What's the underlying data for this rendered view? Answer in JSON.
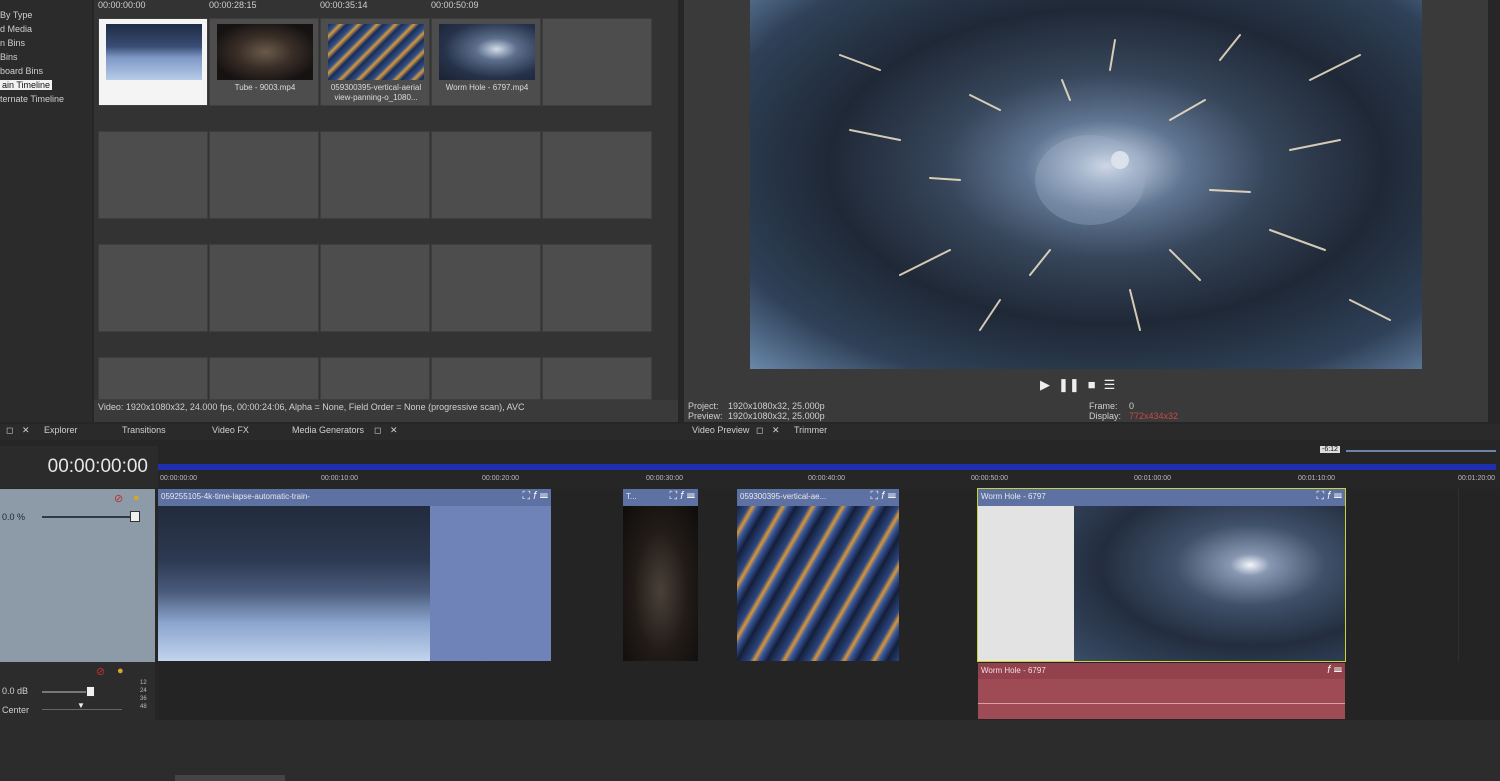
{
  "bins_tree": {
    "items": [
      {
        "label": "By Type",
        "selected": false
      },
      {
        "label": "d Media",
        "selected": false
      },
      {
        "label": "n Bins",
        "selected": false
      },
      {
        "label": "Bins",
        "selected": false
      },
      {
        "label": "board Bins",
        "selected": false
      },
      {
        "label": "ain Timeline",
        "selected": true
      },
      {
        "label": "ternate Timeline",
        "selected": false
      }
    ]
  },
  "media": {
    "timecodes": [
      "00:00:00:00",
      "00:00:28:15",
      "00:00:35:14",
      "00:00:50:09"
    ],
    "items": [
      {
        "caption": "",
        "selected": true,
        "thumb": "city-train"
      },
      {
        "caption": "Tube - 9003.mp4",
        "selected": false,
        "thumb": "tube"
      },
      {
        "caption": "059300395-vertical-aerial view-panning-o_1080...",
        "selected": false,
        "thumb": "highway"
      },
      {
        "caption": "Worm Hole - 6797.mp4",
        "selected": false,
        "thumb": "wormhole"
      }
    ],
    "info": "Video: 1920x1080x32, 24.000 fps, 00:00:24:06, Alpha = None, Field Order = None (progressive scan), AVC"
  },
  "preview": {
    "project_label": "Project:",
    "project_value": "1920x1080x32, 25.000p",
    "preview_label": "Preview:",
    "preview_value": "1920x1080x32, 25.000p",
    "frame_label": "Frame:",
    "frame_value": "0",
    "display_label": "Display:",
    "display_value": "772x434x32",
    "display_color": "#c44b4b",
    "transport": [
      "play-icon",
      "pause-icon",
      "stop-icon",
      "menu-icon"
    ]
  },
  "tabs": {
    "left": [
      "Explorer",
      "Transitions",
      "Video FX",
      "Media Generators"
    ],
    "right": [
      "Video Preview",
      "Trimmer"
    ]
  },
  "timeline": {
    "timecode": "00:00:00:00",
    "zoom_label": "-6:12",
    "ruler_ticks": [
      "00:00:00:00",
      "00:00:10:00",
      "00:00:20:00",
      "00:00:30:00",
      "00:00:40:00",
      "00:00:50:00",
      "00:01:00:00",
      "00:01:10:00",
      "00:01:20:00"
    ],
    "video_track": {
      "level": "0.0 %"
    },
    "audio_track": {
      "volume": "0.0 dB",
      "pan": "Center",
      "meter_labels": [
        "12",
        "24",
        "36",
        "48"
      ]
    },
    "video_clips": [
      {
        "name": "059255105-4k-time-lapse-automatic-train-",
        "thumb": "city-train"
      },
      {
        "name": "T...",
        "thumb": "tube"
      },
      {
        "name": "059300395-vertical-ae...",
        "thumb": "highway"
      },
      {
        "name": "Worm Hole - 6797",
        "thumb": "wormhole"
      }
    ],
    "audio_clips": [
      {
        "name": "Worm Hole - 6797"
      }
    ]
  },
  "colors": {
    "video_clip": "#6f83b8",
    "audio_clip": "#9e4b56",
    "ruler_bar": "#1f2fb0",
    "selection_outline": "#c8d23a"
  }
}
